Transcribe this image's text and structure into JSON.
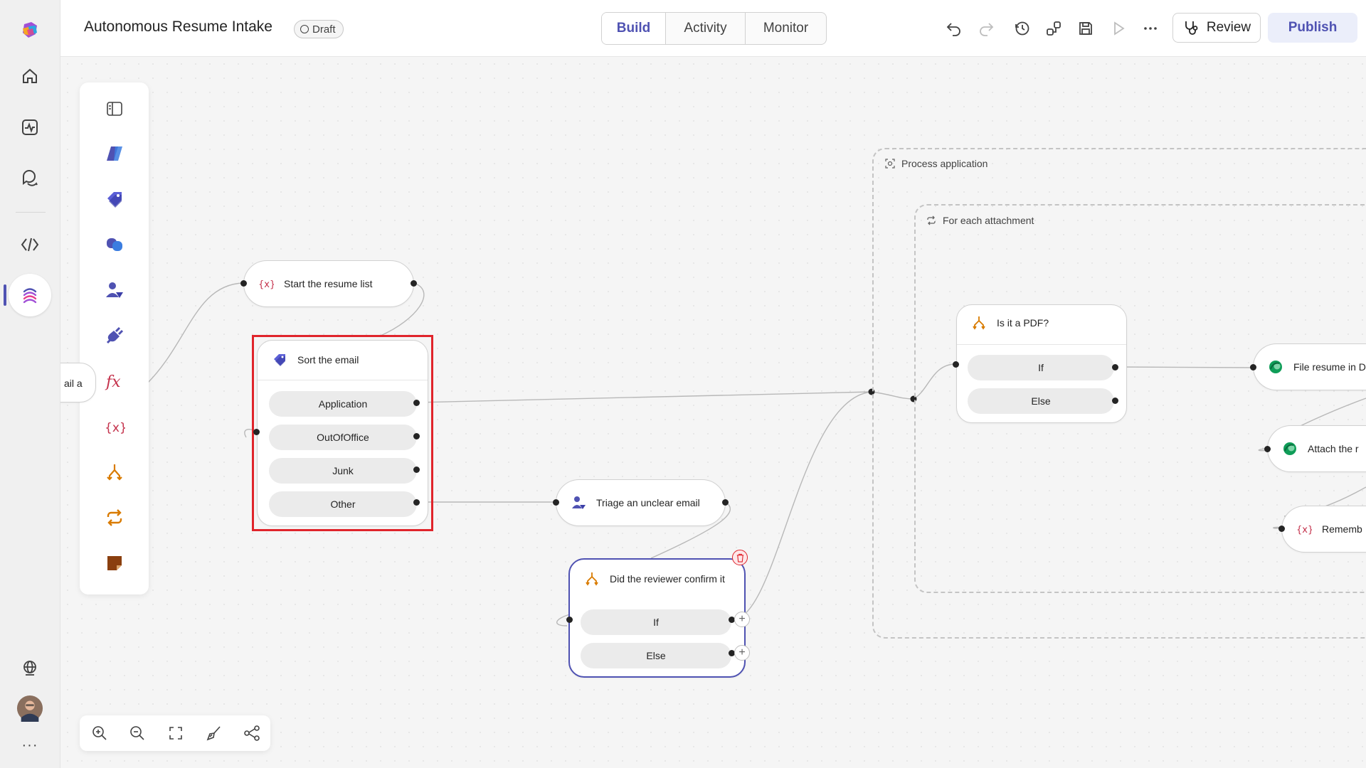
{
  "app": {
    "title": "Autonomous Resume Intake",
    "status_badge": "Draft"
  },
  "rail": {
    "items": [
      {
        "name": "app-logo-icon"
      },
      {
        "name": "home-icon"
      },
      {
        "name": "activity-icon"
      },
      {
        "name": "chat-icon"
      },
      {
        "name": "code-icon"
      },
      {
        "name": "flows-icon"
      },
      {
        "name": "globe-icon"
      },
      {
        "name": "avatar"
      },
      {
        "name": "more-icon",
        "label": "···"
      }
    ]
  },
  "tabs": [
    {
      "label": "Build",
      "active": true
    },
    {
      "label": "Activity",
      "active": false
    },
    {
      "label": "Monitor",
      "active": false
    }
  ],
  "toolbar": {
    "icons": [
      "undo-icon",
      "redo-icon",
      "history-icon",
      "connections-icon",
      "save-icon",
      "run-icon",
      "more-icon"
    ],
    "review_label": "Review",
    "publish_label": "Publish"
  },
  "palette": {
    "icons": [
      "panel-toggle-icon",
      "code-icon",
      "tag-icon",
      "copilot-icon",
      "human-icon",
      "connector-icon",
      "formula-icon",
      "variable-icon",
      "condition-icon",
      "loop-icon",
      "note-icon"
    ]
  },
  "zoom_toolbar": {
    "icons": [
      "zoom-in-icon",
      "zoom-out-icon",
      "fit-view-icon",
      "clean-up-icon",
      "layout-icon"
    ]
  },
  "canvas": {
    "groups": {
      "process_application": "Process application",
      "for_each_attachment": "For each attachment"
    },
    "nodes": {
      "partial_left": "ail a",
      "start_resume_list": "Start the resume list",
      "sort_email": {
        "title": "Sort the email",
        "branches": [
          "Application",
          "OutOfOffice",
          "Junk",
          "Other"
        ]
      },
      "triage": "Triage an unclear email",
      "reviewer_confirm": {
        "title": "Did the reviewer confirm it",
        "branches": [
          "If",
          "Else"
        ]
      },
      "is_pdf": {
        "title": "Is it a PDF?",
        "branches": [
          "If",
          "Else"
        ]
      },
      "file_resume": "File resume in D",
      "attach": "Attach the r",
      "remember": "Rememb"
    }
  },
  "colors": {
    "accent": "#4f52b2",
    "selection": "#e0242b",
    "variable": "#c4314b",
    "condition": "#d97b00",
    "dataverse": "#0f9d58"
  }
}
